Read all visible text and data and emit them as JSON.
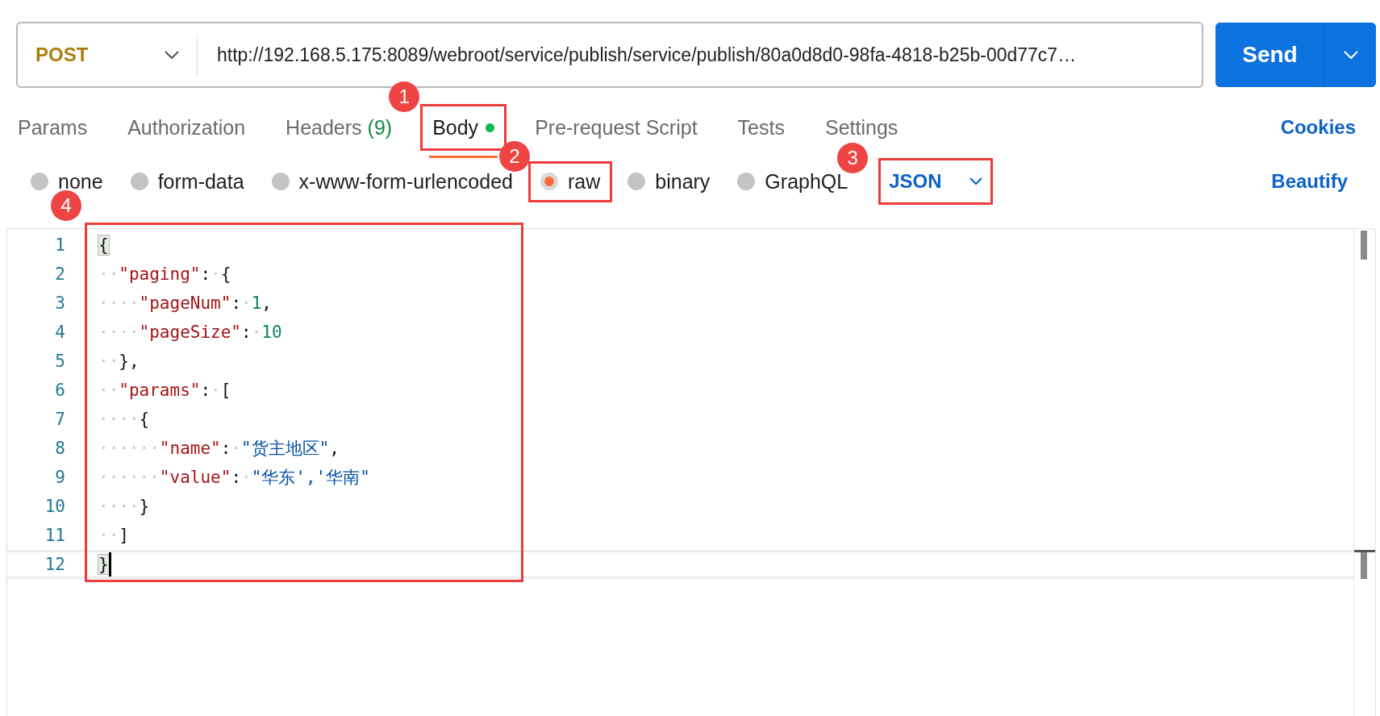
{
  "request": {
    "method": "POST",
    "url": "http://192.168.5.175:8089/webroot/service/publish/service/publish/80a0d8d0-98fa-4818-b25b-00d77c7…",
    "send": "Send"
  },
  "tabs": [
    {
      "label": "Params",
      "selected": false
    },
    {
      "label": "Authorization",
      "selected": false
    },
    {
      "label": "Headers",
      "count": "(9)",
      "selected": false
    },
    {
      "label": "Body",
      "dot": true,
      "selected": true,
      "callout": "1"
    },
    {
      "label": "Pre-request Script",
      "selected": false
    },
    {
      "label": "Tests",
      "selected": false
    },
    {
      "label": "Settings",
      "selected": false
    }
  ],
  "cookies": "Cookies",
  "body_types": [
    {
      "label": "none",
      "selected": false
    },
    {
      "label": "form-data",
      "selected": false
    },
    {
      "label": "x-www-form-urlencoded",
      "selected": false
    },
    {
      "label": "raw",
      "selected": true,
      "callout": "2"
    },
    {
      "label": "binary",
      "selected": false
    },
    {
      "label": "GraphQL",
      "selected": false
    }
  ],
  "language": {
    "label": "JSON",
    "callout": "3"
  },
  "beautify": "Beautify",
  "editor": {
    "callout": "4",
    "lines": [
      {
        "number": "1",
        "active": false,
        "cursor": false,
        "tokens": [
          {
            "kind": "match",
            "text": "{"
          }
        ]
      },
      {
        "number": "2",
        "active": false,
        "cursor": false,
        "tokens": [
          {
            "kind": "ws",
            "text": "··"
          },
          {
            "kind": "key",
            "text": "\"paging\""
          },
          {
            "kind": "punct",
            "text": ":"
          },
          {
            "kind": "ws",
            "text": "·"
          },
          {
            "kind": "punct",
            "text": "{"
          }
        ]
      },
      {
        "number": "3",
        "active": false,
        "cursor": false,
        "tokens": [
          {
            "kind": "ws",
            "text": "····"
          },
          {
            "kind": "key",
            "text": "\"pageNum\""
          },
          {
            "kind": "punct",
            "text": ":"
          },
          {
            "kind": "ws",
            "text": "·"
          },
          {
            "kind": "number",
            "text": "1"
          },
          {
            "kind": "punct",
            "text": ","
          }
        ]
      },
      {
        "number": "4",
        "active": false,
        "cursor": false,
        "tokens": [
          {
            "kind": "ws",
            "text": "····"
          },
          {
            "kind": "key",
            "text": "\"pageSize\""
          },
          {
            "kind": "punct",
            "text": ":"
          },
          {
            "kind": "ws",
            "text": "·"
          },
          {
            "kind": "number",
            "text": "10"
          }
        ]
      },
      {
        "number": "5",
        "active": false,
        "cursor": false,
        "tokens": [
          {
            "kind": "ws",
            "text": "··"
          },
          {
            "kind": "punct",
            "text": "},"
          }
        ]
      },
      {
        "number": "6",
        "active": false,
        "cursor": false,
        "tokens": [
          {
            "kind": "ws",
            "text": "··"
          },
          {
            "kind": "key",
            "text": "\"params\""
          },
          {
            "kind": "punct",
            "text": ":"
          },
          {
            "kind": "ws",
            "text": "·"
          },
          {
            "kind": "punct",
            "text": "["
          }
        ]
      },
      {
        "number": "7",
        "active": false,
        "cursor": false,
        "tokens": [
          {
            "kind": "ws",
            "text": "····"
          },
          {
            "kind": "punct",
            "text": "{"
          }
        ]
      },
      {
        "number": "8",
        "active": false,
        "cursor": false,
        "tokens": [
          {
            "kind": "ws",
            "text": "······"
          },
          {
            "kind": "key",
            "text": "\"name\""
          },
          {
            "kind": "punct",
            "text": ":"
          },
          {
            "kind": "ws",
            "text": "·"
          },
          {
            "kind": "string",
            "text": "\"货主地区\""
          },
          {
            "kind": "punct",
            "text": ","
          }
        ]
      },
      {
        "number": "9",
        "active": false,
        "cursor": false,
        "tokens": [
          {
            "kind": "ws",
            "text": "······"
          },
          {
            "kind": "key",
            "text": "\"value\""
          },
          {
            "kind": "punct",
            "text": ":"
          },
          {
            "kind": "ws",
            "text": "·"
          },
          {
            "kind": "string",
            "text": "\"华东','华南\""
          }
        ]
      },
      {
        "number": "10",
        "active": false,
        "cursor": false,
        "tokens": [
          {
            "kind": "ws",
            "text": "····"
          },
          {
            "kind": "punct",
            "text": "}"
          }
        ]
      },
      {
        "number": "11",
        "active": false,
        "cursor": false,
        "tokens": [
          {
            "kind": "ws",
            "text": "··"
          },
          {
            "kind": "punct",
            "text": "]"
          }
        ]
      },
      {
        "number": "12",
        "active": true,
        "cursor": true,
        "tokens": [
          {
            "kind": "match",
            "text": "}"
          }
        ]
      }
    ]
  }
}
